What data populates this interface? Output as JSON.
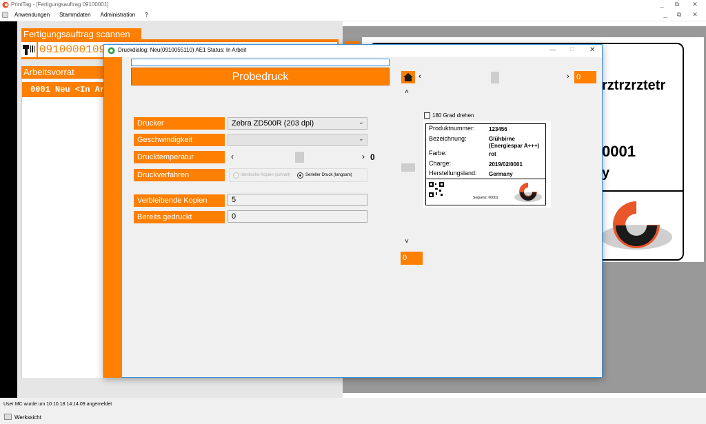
{
  "app": {
    "title": "PrintTag - [Fertigungsauftrag 09100001]",
    "window_controls": {
      "minimize": "_",
      "restore": "⧉",
      "close": "✕"
    },
    "mdi_controls": {
      "minimize": "_",
      "restore": "⧉",
      "close": "✕"
    }
  },
  "menu": {
    "items": [
      "Anwendungen",
      "Stammdaten",
      "Administration",
      "?"
    ]
  },
  "scan_panel": {
    "header": "Fertigungsauftrag scannen",
    "input_value": "0910000109100",
    "scanner_icon": "barcode-scanner-icon"
  },
  "worklist": {
    "header": "Arbeitsvorrat",
    "rows": [
      "0001 Neu <In Arbeit"
    ]
  },
  "background_label": {
    "line1": "rztrzrztetr",
    "line2": "0001",
    "line3": "y"
  },
  "dialog": {
    "title": "Druckdialog: Neu(0910055110) AE1 Status: In Arbeit",
    "controls": {
      "minimize": "—",
      "maximize": "□",
      "close": "✕"
    },
    "top_input_value": "",
    "probedruck_label": "Probedruck",
    "printer": {
      "label": "Drucker",
      "value": "Zebra ZD500R (203 dpi)"
    },
    "speed": {
      "label": "Geschwindigkeit",
      "value": ""
    },
    "temperature": {
      "label": "Drucktemperatur",
      "value": "0",
      "left_arrow": "‹",
      "right_arrow": "›",
      "level": 0.5
    },
    "method": {
      "label": "Druckverfahren",
      "options": [
        "Identische Kopien (schnell)",
        "Serieller Druck (langsam)"
      ],
      "selected": "Serieller Druck (langsam)"
    },
    "remaining": {
      "label": "Verbleibende Kopien",
      "value": "5"
    },
    "printed": {
      "label": "Bereits gedruckt",
      "value": "0"
    },
    "preview": {
      "home_icon": "home-icon",
      "h_left_arrow": "‹",
      "h_right_arrow": "›",
      "h_value": "0",
      "v_up_arrow": "˄",
      "v_down_arrow": "˅",
      "v_value": "0",
      "rotate_label": "180 Grad drehen",
      "label_fields": [
        {
          "key": "Produktnummer:",
          "value": "123456"
        },
        {
          "key": "Bezeichnung:",
          "value": "Glühbirne (Energiespar A+++)"
        },
        {
          "key": "Farbe:",
          "value": "rot"
        },
        {
          "key": "Charge:",
          "value": "2019/02/0001"
        },
        {
          "key": "Herstellungsland:",
          "value": "Germany"
        }
      ],
      "sequence_text": "Sequenz: 00001"
    }
  },
  "status_bar": {
    "message": "User MC wurde um 10.10.18 14:14:09 angemeldet",
    "button": "Werkssicht"
  },
  "colors": {
    "accent": "#ff7f00",
    "dark": "#000000",
    "panel": "#e6e6e6"
  }
}
